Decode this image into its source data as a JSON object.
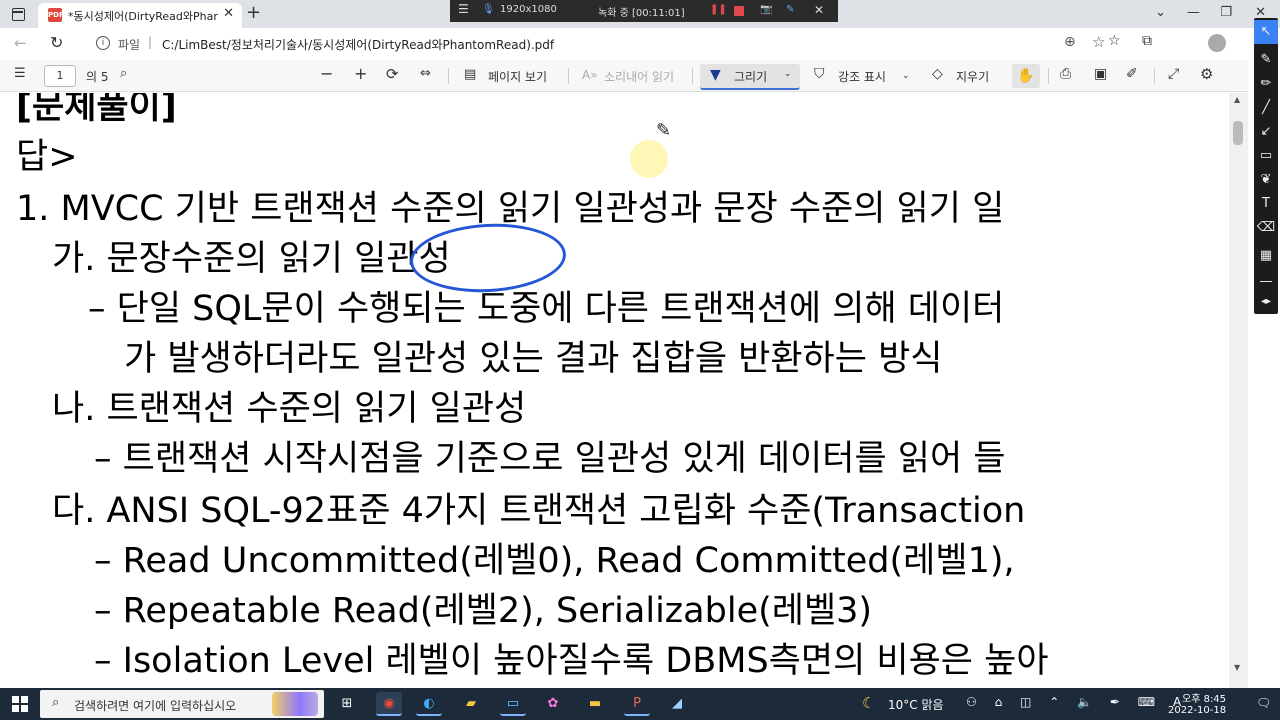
{
  "browser": {
    "tab_title": "*동시성제어(DirtyRead와PhantomRead).pdf",
    "tab_icon_text": "PDF",
    "new_tab": "+",
    "address_prefix": "파일",
    "address_url": "C:/LimBest/정보처리기술사/동시성제어(DirtyRead와PhantomRead).pdf"
  },
  "recorder": {
    "resolution": "1920x1080",
    "status": "녹화 중 [00:11:01]"
  },
  "pdf_toolbar": {
    "page_current": "1",
    "page_total": "의 5",
    "page_view": "페이지 보기",
    "read_aloud": "소리내어 읽기",
    "draw": "그리기",
    "highlight": "강조 표시",
    "erase": "지우기"
  },
  "document": {
    "lines": [
      "[문제풀이]",
      "답>",
      "1. MVCC 기반 트랜잭션 수준의 읽기 일관성과 문장 수준의 읽기 일",
      "가. 문장수준의 읽기 일관성",
      "– 단일 SQL문이 수행되는 도중에 다른 트랜잭션에 의해 데이터",
      "가 발생하더라도 일관성 있는 결과 집합을 반환하는 방식",
      "나. 트랜잭션 수준의 읽기 일관성",
      "– 트랜잭션 시작시점을 기준으로 일관성 있게 데이터를 읽어 들",
      "다. ANSI SQL-92표준 4가지 트랜잭션 고립화 수준(Transaction",
      "– Read Uncommitted(레벨0), Read Committed(레벨1),",
      "– Repeatable Read(레벨2), Serializable(레벨3)",
      "– Isolation Level 레벨이 높아질수록 DBMS측면의 비용은 높아"
    ]
  },
  "taskbar": {
    "search_placeholder": "검색하려면 여기에 입력하십시오",
    "weather": "10°C 맑음",
    "time": "오후 8:45",
    "date": "2022-10-18"
  },
  "colors": {
    "annotation_ink": "#2456d6",
    "taskbar_bg": "#1d2a3a",
    "rec_red": "#e0484d"
  }
}
